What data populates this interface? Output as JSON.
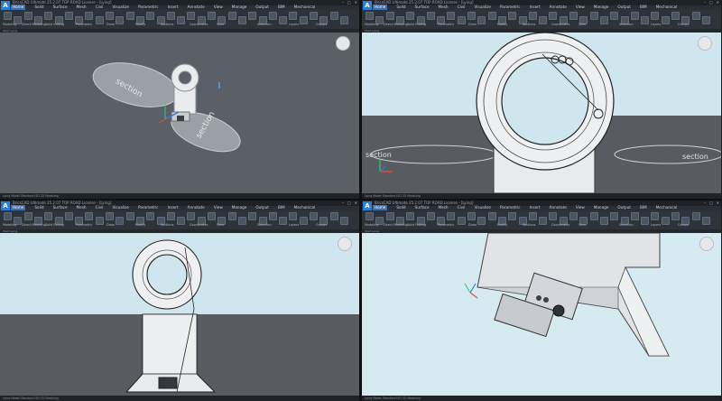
{
  "app": {
    "title": "BricsCAD Ultimate 25.2.07 TOP ROAD License - [Lying]",
    "logo_letter": "A",
    "window_controls": [
      "–",
      "□",
      "✕"
    ]
  },
  "menu": {
    "tabs": [
      "Home",
      "Solid",
      "Surface",
      "Mesh",
      "Civil",
      "Visualize",
      "Parametric",
      "Insert",
      "Annotate",
      "View",
      "Manage",
      "Output",
      "BIM",
      "Mechanical"
    ]
  },
  "ribbon": {
    "groups": [
      "Modeling",
      "Direct Modeling",
      "Solid Editing",
      "Parametric",
      "Draw",
      "Modify",
      "Sections",
      "Coordinates",
      "View",
      "Selection",
      "Layers",
      "Groups"
    ]
  },
  "views": [
    {
      "id": "view-top-left",
      "doc_tab": "Start  Lying",
      "status": "Lying  Model  Standard  ISO-25  Modeling",
      "section_labels": [
        "section",
        "section"
      ],
      "background": "#5b6066"
    },
    {
      "id": "view-top-right",
      "doc_tab": "Start  Lying",
      "status": "Lying  Model  Standard  ISO-25  Modeling",
      "section_labels": [
        "section",
        "section"
      ],
      "sky_color": "#cfe6ef",
      "ground_color": "#585c61"
    },
    {
      "id": "view-bottom-left",
      "doc_tab": "Start  Lying",
      "status": "Lying  Model  Standard  ISO-25  Modeling",
      "sky_color": "#cfe6ef",
      "ground_color": "#585c61"
    },
    {
      "id": "view-bottom-right",
      "doc_tab": "Start  Lying",
      "status": "Lying  Model  Standard  ISO-25  Modeling",
      "background": "#d6eaf2"
    }
  ]
}
